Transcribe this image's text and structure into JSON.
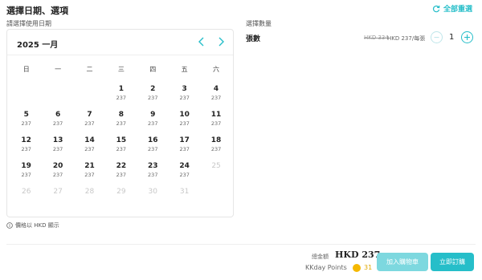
{
  "header": {
    "title": "選擇日期、選項",
    "reset_label": "全部重選"
  },
  "date_section": {
    "label": "請選擇使用日期"
  },
  "quantity_section": {
    "label": "選擇數量"
  },
  "calendar": {
    "month": "2025 一月",
    "weekdays": [
      "日",
      "一",
      "二",
      "三",
      "四",
      "五",
      "六"
    ],
    "leading_empty": 3,
    "days": [
      {
        "d": "1",
        "p": "237",
        "disabled": false
      },
      {
        "d": "2",
        "p": "237",
        "disabled": false
      },
      {
        "d": "3",
        "p": "237",
        "disabled": false
      },
      {
        "d": "4",
        "p": "237",
        "disabled": false
      },
      {
        "d": "5",
        "p": "237",
        "disabled": false
      },
      {
        "d": "6",
        "p": "237",
        "disabled": false
      },
      {
        "d": "7",
        "p": "237",
        "disabled": false
      },
      {
        "d": "8",
        "p": "237",
        "disabled": false
      },
      {
        "d": "9",
        "p": "237",
        "disabled": false
      },
      {
        "d": "10",
        "p": "237",
        "disabled": false
      },
      {
        "d": "11",
        "p": "237",
        "disabled": false
      },
      {
        "d": "12",
        "p": "237",
        "disabled": false
      },
      {
        "d": "13",
        "p": "237",
        "disabled": false
      },
      {
        "d": "14",
        "p": "237",
        "disabled": false
      },
      {
        "d": "15",
        "p": "237",
        "disabled": false
      },
      {
        "d": "16",
        "p": "237",
        "disabled": false
      },
      {
        "d": "17",
        "p": "237",
        "disabled": false
      },
      {
        "d": "18",
        "p": "237",
        "disabled": false
      },
      {
        "d": "19",
        "p": "237",
        "disabled": false
      },
      {
        "d": "20",
        "p": "237",
        "disabled": false
      },
      {
        "d": "21",
        "p": "237",
        "disabled": false
      },
      {
        "d": "22",
        "p": "237",
        "disabled": false
      },
      {
        "d": "23",
        "p": "237",
        "disabled": false
      },
      {
        "d": "24",
        "p": "237",
        "disabled": false
      },
      {
        "d": "25",
        "p": "",
        "disabled": true
      },
      {
        "d": "26",
        "p": "",
        "disabled": true
      },
      {
        "d": "27",
        "p": "",
        "disabled": true
      },
      {
        "d": "28",
        "p": "",
        "disabled": true
      },
      {
        "d": "29",
        "p": "",
        "disabled": true
      },
      {
        "d": "30",
        "p": "",
        "disabled": true
      },
      {
        "d": "31",
        "p": "",
        "disabled": true
      }
    ]
  },
  "price_note": "價格以 HKD 顯示",
  "ticket": {
    "name": "張數",
    "original_price": "HKD 334",
    "price": "HKD 237/每張",
    "quantity": "1"
  },
  "footer": {
    "total_label": "總金額",
    "total_amount": "HKD 237",
    "points_label": "KKday Points",
    "points_value": "31",
    "add_to_cart": "加入購物車",
    "book_now": "立即訂購"
  },
  "colors": {
    "accent": "#26bec9",
    "accent_light": "#7dd8df",
    "points": "#f5b800"
  }
}
